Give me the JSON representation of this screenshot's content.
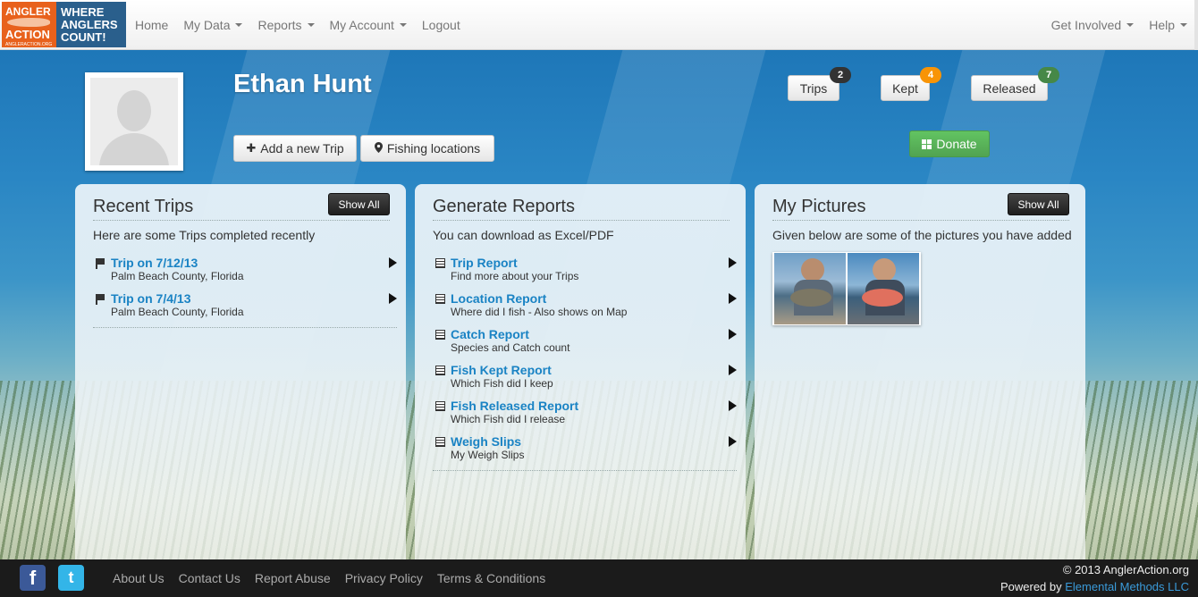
{
  "logo": {
    "left_line1": "ANGLER",
    "left_line2": "ACTION",
    "left_small": "ANGLERACTION.ORG",
    "right_line1": "WHERE",
    "right_line2": "ANGLERS",
    "right_line3": "COUNT!",
    "colors": {
      "left": "#e8611c",
      "right": "#2a5f8c"
    }
  },
  "nav": {
    "left": [
      {
        "label": "Home",
        "dropdown": false
      },
      {
        "label": "My Data",
        "dropdown": true
      },
      {
        "label": "Reports",
        "dropdown": true
      },
      {
        "label": "My Account",
        "dropdown": true
      },
      {
        "label": "Logout",
        "dropdown": false
      }
    ],
    "right": [
      {
        "label": "Get Involved",
        "dropdown": true
      },
      {
        "label": "Help",
        "dropdown": true
      }
    ]
  },
  "profile": {
    "name": "Ethan Hunt",
    "add_trip_label": "Add a new Trip",
    "fishing_locations_label": "Fishing locations",
    "stats": [
      {
        "label": "Trips",
        "count": "2",
        "badge_color": "#333333"
      },
      {
        "label": "Kept",
        "count": "4",
        "badge_color": "#f89406"
      },
      {
        "label": "Released",
        "count": "7",
        "badge_color": "#468847"
      }
    ],
    "donate_label": "Donate"
  },
  "recent_trips": {
    "title": "Recent Trips",
    "show_all": "Show All",
    "subtitle": "Here are some Trips completed recently",
    "items": [
      {
        "title": "Trip on 7/12/13",
        "subtitle": "Palm Beach County, Florida"
      },
      {
        "title": "Trip on 7/4/13",
        "subtitle": "Palm Beach County, Florida"
      }
    ]
  },
  "reports": {
    "title": "Generate Reports",
    "subtitle": "You can download as Excel/PDF",
    "items": [
      {
        "title": "Trip Report",
        "subtitle": "Find more about your Trips"
      },
      {
        "title": "Location Report",
        "subtitle": "Where did I fish - Also shows on Map"
      },
      {
        "title": "Catch Report",
        "subtitle": "Species and Catch count"
      },
      {
        "title": "Fish Kept Report",
        "subtitle": "Which Fish did I keep"
      },
      {
        "title": "Fish Released Report",
        "subtitle": "Which Fish did I release"
      },
      {
        "title": "Weigh Slips",
        "subtitle": "My Weigh Slips"
      }
    ]
  },
  "pictures": {
    "title": "My Pictures",
    "show_all": "Show All",
    "subtitle": "Given below are some of the pictures you have added"
  },
  "footer": {
    "links": [
      "About Us",
      "Contact Us",
      "Report Abuse",
      "Privacy Policy",
      "Terms & Conditions"
    ],
    "copyright": "© 2013 AnglerAction.org",
    "powered_prefix": "Powered by",
    "powered_link": "Elemental Methods LLC"
  }
}
